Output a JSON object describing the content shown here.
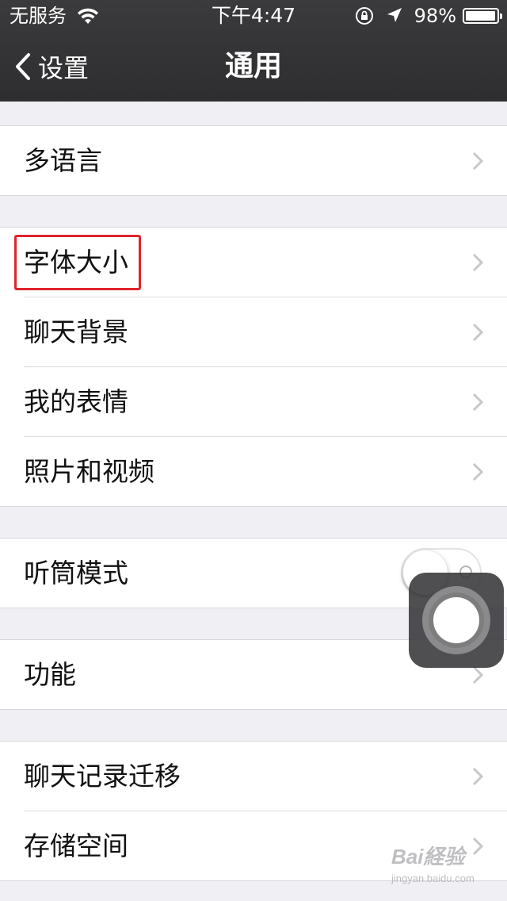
{
  "status_bar": {
    "carrier": "无服务",
    "time": "下午4:47",
    "battery_percent_text": "98%",
    "battery_level": 0.98,
    "icons": [
      "wifi-icon",
      "orientation-lock-icon",
      "location-arrow-icon",
      "battery-icon"
    ]
  },
  "nav": {
    "back_label": "设置",
    "title": "通用"
  },
  "groups": [
    {
      "items": [
        {
          "label": "多语言",
          "accessory": "chevron"
        }
      ]
    },
    {
      "items": [
        {
          "label": "字体大小",
          "accessory": "chevron",
          "highlighted": true
        },
        {
          "label": "聊天背景",
          "accessory": "chevron"
        },
        {
          "label": "我的表情",
          "accessory": "chevron"
        },
        {
          "label": "照片和视频",
          "accessory": "chevron"
        }
      ]
    },
    {
      "items": [
        {
          "label": "听筒模式",
          "accessory": "toggle",
          "toggle_on": false
        }
      ]
    },
    {
      "items": [
        {
          "label": "功能",
          "accessory": "chevron"
        }
      ]
    },
    {
      "items": [
        {
          "label": "聊天记录迁移",
          "accessory": "chevron"
        },
        {
          "label": "存储空间",
          "accessory": "chevron"
        }
      ]
    }
  ],
  "overlay": {
    "assistive_touch_icon": "assistive-touch-icon"
  },
  "watermark": {
    "line1": "Bai経验",
    "line2": "jingyan.baidu.com"
  },
  "colors": {
    "header_bg": "#333335",
    "page_bg": "#efeff4",
    "highlight_border": "#e0242c",
    "chevron": "#c7c7cc"
  }
}
